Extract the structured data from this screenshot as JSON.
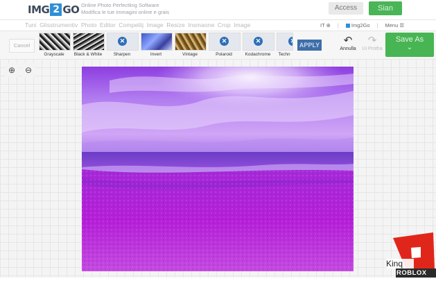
{
  "header": {
    "logo": {
      "left": "IMG",
      "mid": "2",
      "right": "GO"
    },
    "tagline_line1": "Online Photo Perfectling Software",
    "tagline_line2": "Modifica le tue immagini online e grais",
    "access_label": "Access",
    "signin_label": "Sian"
  },
  "nav": {
    "tabs": [
      "Tuni",
      "Glisstrumentiv",
      "Photo",
      "Editor",
      "Compeliij",
      "Image",
      "Resize",
      "Insmaone",
      "Crop",
      "Image"
    ],
    "lang": "IT ⊕",
    "brand_link": "Img2Go",
    "menu": "Menu ☰"
  },
  "toolbar": {
    "cancel_label": "Cancel",
    "filters": [
      {
        "label": "Grayscale"
      },
      {
        "label": "Black & White"
      },
      {
        "label": "Sharpen"
      },
      {
        "label": "Invert"
      },
      {
        "label": "Vintage"
      },
      {
        "label": "Polaroid"
      },
      {
        "label": "Kodachrome"
      },
      {
        "label": "Techn"
      }
    ],
    "apply_label": "APPLY",
    "undo_label": "Annulla",
    "redo_label": "Ui Protha",
    "save_label": "Save As"
  },
  "watermark": {
    "text_kinq": "Kinq",
    "text_roblox": "ROBLOX"
  },
  "colors": {
    "accent_green": "#47b553",
    "accent_blue": "#2f8fd7",
    "photo_sky": "#9a55e8",
    "photo_sand": "#b21fd8"
  }
}
